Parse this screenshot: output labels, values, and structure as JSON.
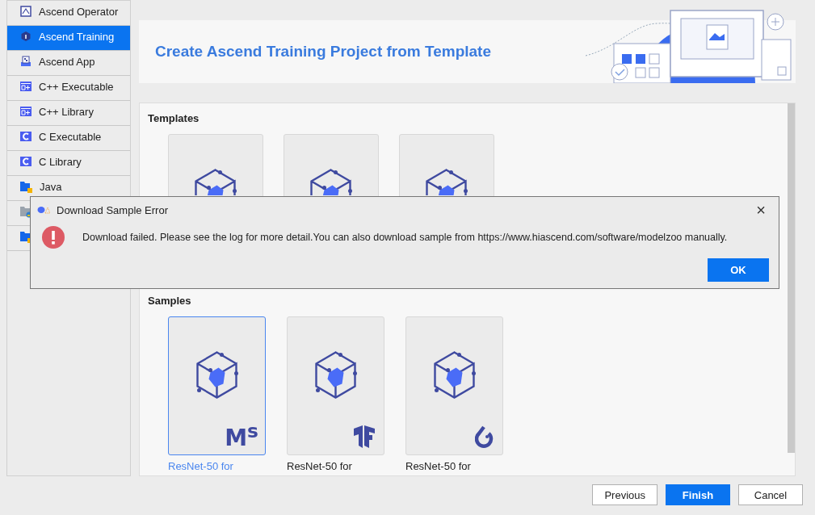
{
  "sidebar": {
    "items": [
      {
        "label": "Ascend Operator",
        "kind": "operator",
        "selected": false
      },
      {
        "label": "Ascend Training",
        "kind": "training",
        "selected": true
      },
      {
        "label": "Ascend App",
        "kind": "app",
        "selected": false
      },
      {
        "label": "C++ Executable",
        "kind": "cpp",
        "selected": false
      },
      {
        "label": "C++ Library",
        "kind": "cpp",
        "selected": false
      },
      {
        "label": "C Executable",
        "kind": "c",
        "selected": false
      },
      {
        "label": "C Library",
        "kind": "c",
        "selected": false
      },
      {
        "label": "Java",
        "kind": "folder",
        "selected": false
      },
      {
        "kind": "python",
        "selected": false
      },
      {
        "kind": "folder",
        "selected": false
      }
    ]
  },
  "header": {
    "title": "Create Ascend Training Project from Template"
  },
  "templates": {
    "heading": "Templates",
    "cards": [
      {
        "selected": false
      },
      {
        "selected": false
      },
      {
        "selected": false
      }
    ]
  },
  "samples": {
    "heading": "Samples",
    "cards": [
      {
        "label": "ResNet-50 for",
        "kind": "mindspore",
        "logo_text": "M$^{s}$",
        "selected": true
      },
      {
        "label": "ResNet-50 for",
        "kind": "tensorflow",
        "selected": false
      },
      {
        "label": "ResNet-50 for",
        "kind": "pytorch",
        "selected": false
      }
    ]
  },
  "footer": {
    "buttons": [
      {
        "label": "Previous",
        "primary": false
      },
      {
        "label": "Finish",
        "primary": true
      },
      {
        "label": "Cancel",
        "primary": false
      }
    ]
  },
  "dialog": {
    "title": "Download Sample Error",
    "close": "×",
    "message": "Download failed. Please see the log for more detail.You can also download sample from https://www.hiascend.com/software/modelzoo manually.",
    "button": "OK"
  }
}
